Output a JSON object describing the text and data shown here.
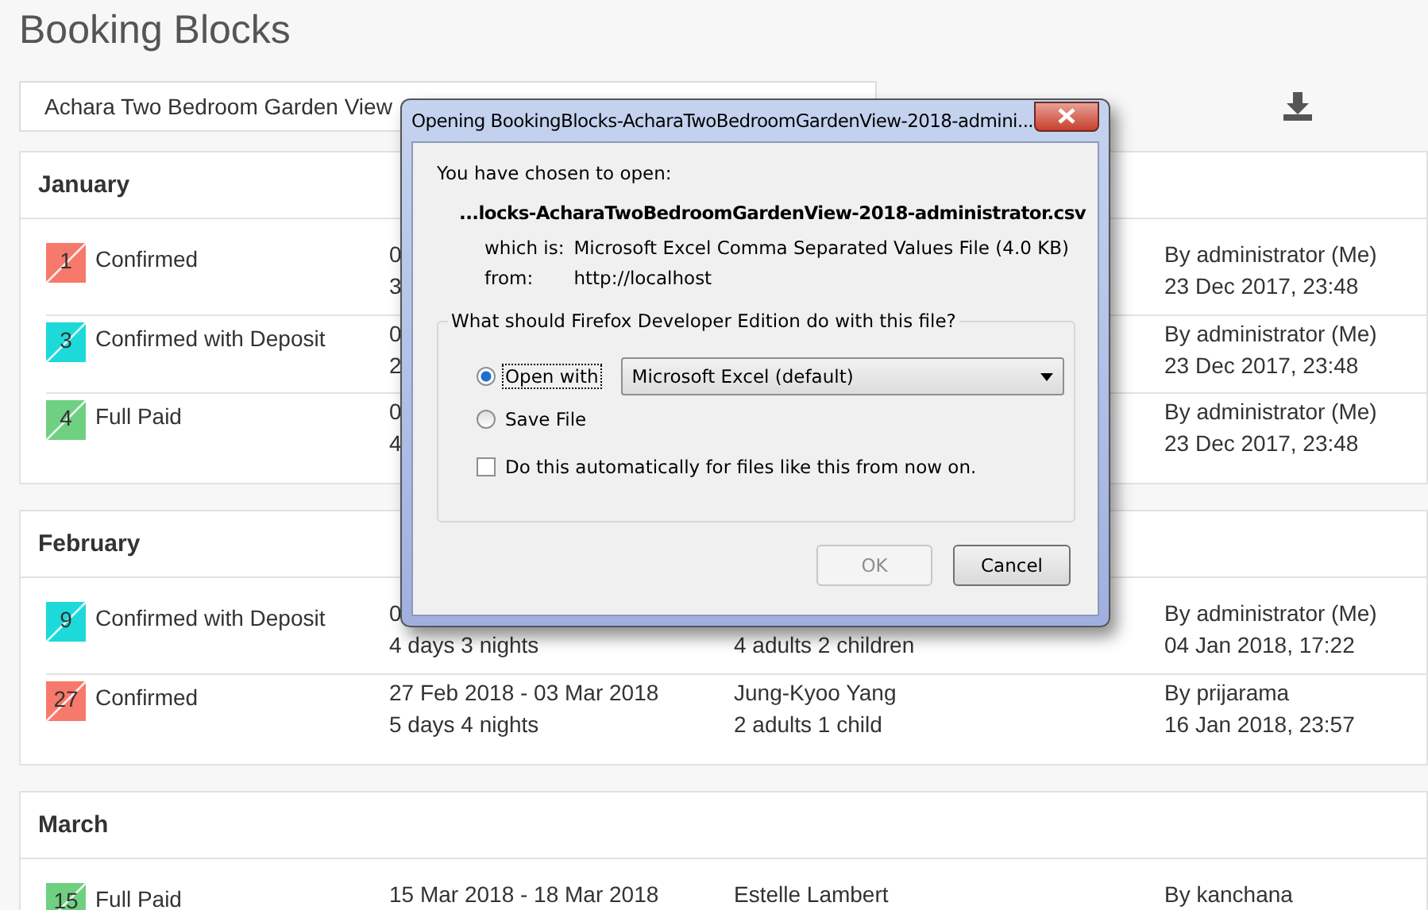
{
  "page": {
    "title": "Booking Blocks",
    "room_select": {
      "value": "Achara Two Bedroom Garden View"
    }
  },
  "months": [
    {
      "name": "January",
      "rows": [
        {
          "day": "1",
          "color": "#f7796c",
          "status": "Confirmed",
          "dates": "0",
          "duration": "3",
          "by": "By administrator (Me)",
          "created": "23 Dec 2017, 23:48"
        },
        {
          "day": "3",
          "color": "#1ed9d9",
          "status": "Confirmed with Deposit",
          "dates": "0",
          "duration": "2",
          "by": "By administrator (Me)",
          "created": "23 Dec 2017, 23:48"
        },
        {
          "day": "4",
          "color": "#6fd082",
          "status": "Full Paid",
          "dates": "0",
          "duration": "4",
          "by": "By administrator (Me)",
          "created": "23 Dec 2017, 23:48"
        }
      ]
    },
    {
      "name": "February",
      "rows": [
        {
          "day": "9",
          "color": "#1ed9d9",
          "status": "Confirmed with Deposit",
          "dates": "0",
          "duration": "4 days 3 nights",
          "guests": "4 adults 2 children",
          "by": "By administrator (Me)",
          "created": "04 Jan 2018, 17:22"
        },
        {
          "day": "27",
          "color": "#f7796c",
          "status": "Confirmed",
          "dates": "27 Feb 2018 - 03 Mar 2018",
          "duration": "5 days 4 nights",
          "guest": "Jung-Kyoo Yang",
          "guests": "2 adults 1 child",
          "by": "By prijarama",
          "created": "16 Jan 2018, 23:57"
        }
      ]
    },
    {
      "name": "March",
      "rows": [
        {
          "day": "15",
          "color": "#6fd082",
          "status": "Full Paid",
          "dates": "15 Mar 2018 - 18 Mar 2018",
          "guest": "Estelle Lambert",
          "by": "By kanchana"
        }
      ]
    }
  ],
  "dialog": {
    "title": "Opening BookingBlocks-AcharaTwoBedroomGardenView-2018-admini...",
    "intro": "You have chosen to open:",
    "file_name": "...locks-AcharaTwoBedroomGardenView-2018-administrator.csv",
    "type_label": "which is:",
    "type_value": "Microsoft Excel Comma Separated Values File (4.0 KB)",
    "from_label": "from:",
    "from_value": "http://localhost",
    "question": "What should Firefox Developer Edition do with this file?",
    "options": [
      {
        "kind": "app",
        "label": "Open with",
        "selected": true,
        "app": "Microsoft Excel (default)"
      },
      {
        "kind": "plain",
        "label": "Save File",
        "selected": false
      }
    ],
    "remember": {
      "label": "Do this automatically for files like this from now on.",
      "checked": false
    },
    "buttons": [
      {
        "label": "OK",
        "disabled": true
      },
      {
        "label": "Cancel",
        "disabled": false
      }
    ]
  }
}
